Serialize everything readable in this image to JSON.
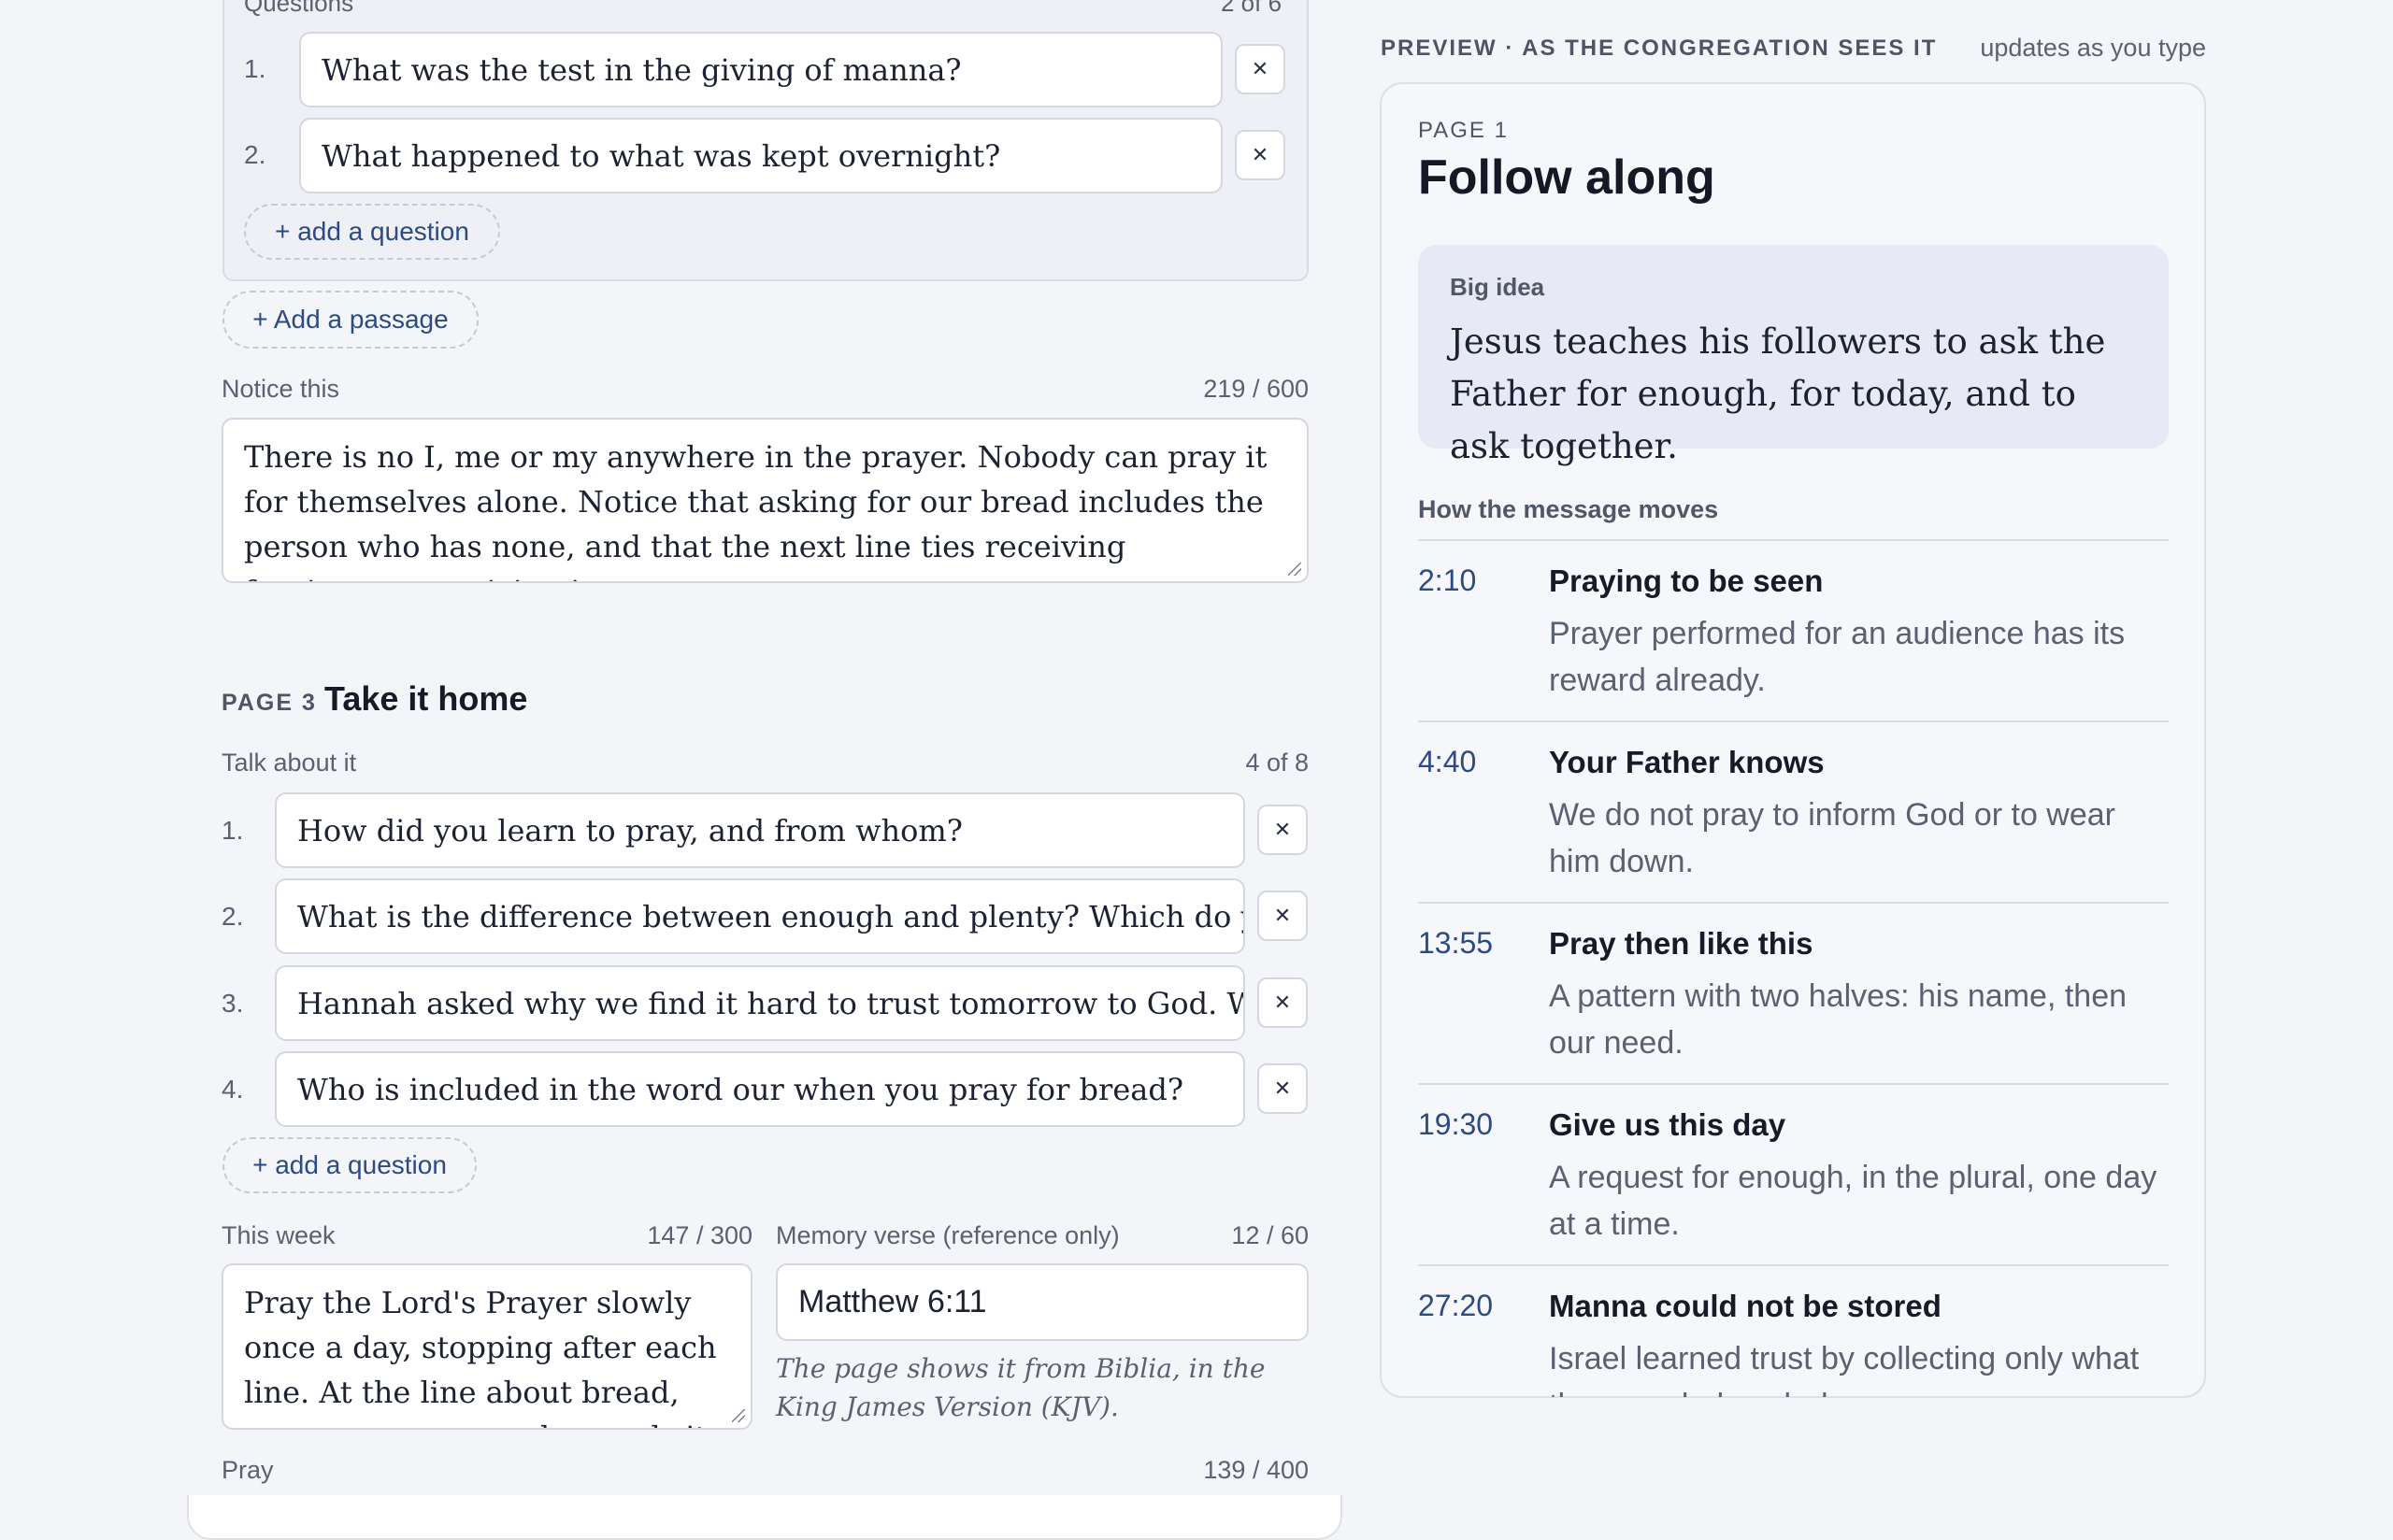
{
  "passage_questions": {
    "label": "Questions",
    "count": "2 of 6",
    "items": [
      {
        "num": "1.",
        "text": "What was the test in the giving of manna?"
      },
      {
        "num": "2.",
        "text": "What happened to what was kept overnight?"
      }
    ],
    "add_label": "+ add a question"
  },
  "add_passage_label": "+ Add a passage",
  "notice": {
    "label": "Notice this",
    "count": "219 / 600",
    "text": "There is no I, me or my anywhere in the prayer. Nobody can pray it for themselves alone. Notice that asking for our bread includes the person who has none, and that the next line ties receiving forgiveness to giving it."
  },
  "page3": {
    "tag": "PAGE 3",
    "title": "Take it home",
    "talk": {
      "label": "Talk about it",
      "count": "4 of 8",
      "items": [
        {
          "num": "1.",
          "text": "How did you learn to pray, and from whom?"
        },
        {
          "num": "2.",
          "text": "What is the difference between enough and plenty? Which do you usually ask for?"
        },
        {
          "num": "3.",
          "text": "Hannah asked why we find it hard to trust tomorrow to God. What is your answer?"
        },
        {
          "num": "4.",
          "text": "Who is included in the word our when you pray for bread?"
        }
      ],
      "add_label": "+ add a question"
    },
    "this_week": {
      "label": "This week",
      "count": "147 / 300",
      "text": "Pray the Lord's Prayer slowly once a day, stopping after each line. At the line about bread, name one person who needs it and something"
    },
    "memory": {
      "label": "Memory verse (reference only)",
      "count": "12 / 60",
      "value": "Matthew 6:11",
      "note": "The page shows it from Biblia, in the King James Version (KJV)."
    },
    "pray": {
      "label": "Pray",
      "count": "139 / 400"
    }
  },
  "preview": {
    "header": "PREVIEW · AS THE CONGREGATION SEES IT",
    "updates": "updates as you type",
    "page_tag": "PAGE 1",
    "title": "Follow along",
    "big_idea": {
      "label": "Big idea",
      "text": "Jesus teaches his followers to ask the Father for enough, for today, and to ask together."
    },
    "moves_label": "How the message moves",
    "moves": [
      {
        "time": "2:10",
        "title": "Praying to be seen",
        "desc": "Prayer performed for an audience has its reward already."
      },
      {
        "time": "4:40",
        "title": "Your Father knows",
        "desc": "We do not pray to inform God or to wear him down."
      },
      {
        "time": "13:55",
        "title": "Pray then like this",
        "desc": "A pattern with two halves: his name, then our need."
      },
      {
        "time": "19:30",
        "title": "Give us this day",
        "desc": "A request for enough, in the plural, one day at a time."
      },
      {
        "time": "27:20",
        "title": "Manna could not be stored",
        "desc": "Israel learned trust by collecting only what they needed each day."
      }
    ]
  },
  "icons": {
    "remove": "close-icon"
  },
  "colors": {
    "accent": "#2c4a84",
    "panel": "#eef0f5",
    "big_idea_bg": "#e7eaf6"
  }
}
